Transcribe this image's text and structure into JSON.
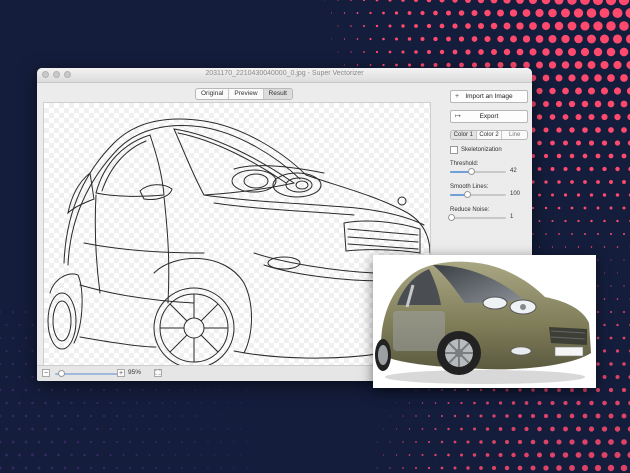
{
  "window": {
    "title": "2031170_2210430040000_0.jpg - Super Vectorizer",
    "view_tabs": [
      {
        "label": "Original",
        "active": false
      },
      {
        "label": "Preview",
        "active": false
      },
      {
        "label": "Result",
        "active": true
      }
    ]
  },
  "side_panel": {
    "import_label": "Import an Image",
    "import_icon": "+",
    "export_label": "Export",
    "export_icon": "↦",
    "mode_tabs": [
      {
        "label": "Color 1",
        "active": true
      },
      {
        "label": "Color 2",
        "active": false
      },
      {
        "label": "Line",
        "active": false
      }
    ],
    "skeletonization_label": "Skeletonization",
    "skeletonization_checked": false,
    "sliders": [
      {
        "label": "Threshold:",
        "value": "42",
        "fraction": 0.38
      },
      {
        "label": "Smooth Lines:",
        "value": "100",
        "fraction": 0.3
      },
      {
        "label": "Reduce Noise:",
        "value": "1",
        "fraction": 0.02
      }
    ]
  },
  "zoom": {
    "minus": "−",
    "plus": "+",
    "value": "95%",
    "fraction": 0.1
  },
  "colors": {
    "background": "#141d3c",
    "dots": "#ff4a6e",
    "car_body": "#8c8a66"
  }
}
